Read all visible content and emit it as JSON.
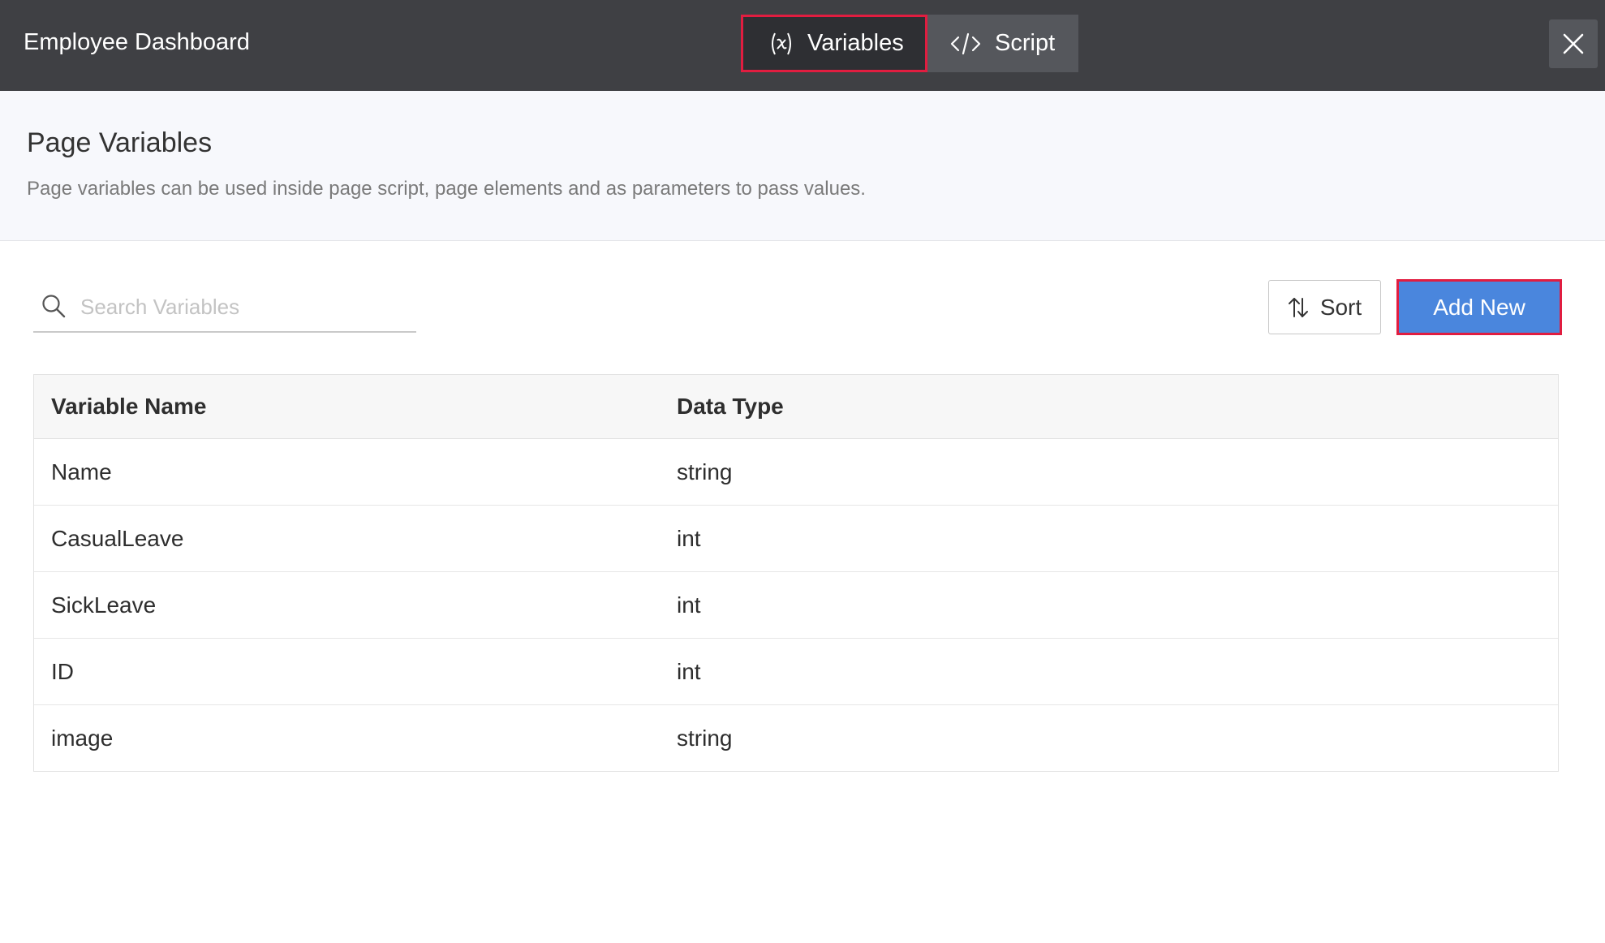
{
  "header": {
    "app_title": "Employee Dashboard",
    "tabs": [
      {
        "label": "Variables",
        "icon": "variable-icon",
        "active": true
      },
      {
        "label": "Script",
        "icon": "code-icon",
        "active": false
      }
    ],
    "close_icon": "close-icon"
  },
  "page": {
    "title": "Page Variables",
    "description": "Page variables can be used inside page script, page elements and as parameters to pass values."
  },
  "toolbar": {
    "search_placeholder": "Search Variables",
    "search_value": "",
    "sort_label": "Sort",
    "add_label": "Add New"
  },
  "table": {
    "columns": [
      "Variable Name",
      "Data Type"
    ],
    "rows": [
      {
        "name": "Name",
        "type": "string"
      },
      {
        "name": "CasualLeave",
        "type": "int"
      },
      {
        "name": "SickLeave",
        "type": "int"
      },
      {
        "name": "ID",
        "type": "int"
      },
      {
        "name": "image",
        "type": "string"
      }
    ]
  },
  "colors": {
    "topbar": "#3f4044",
    "highlight": "#e11d40",
    "primary": "#4a86dd"
  }
}
